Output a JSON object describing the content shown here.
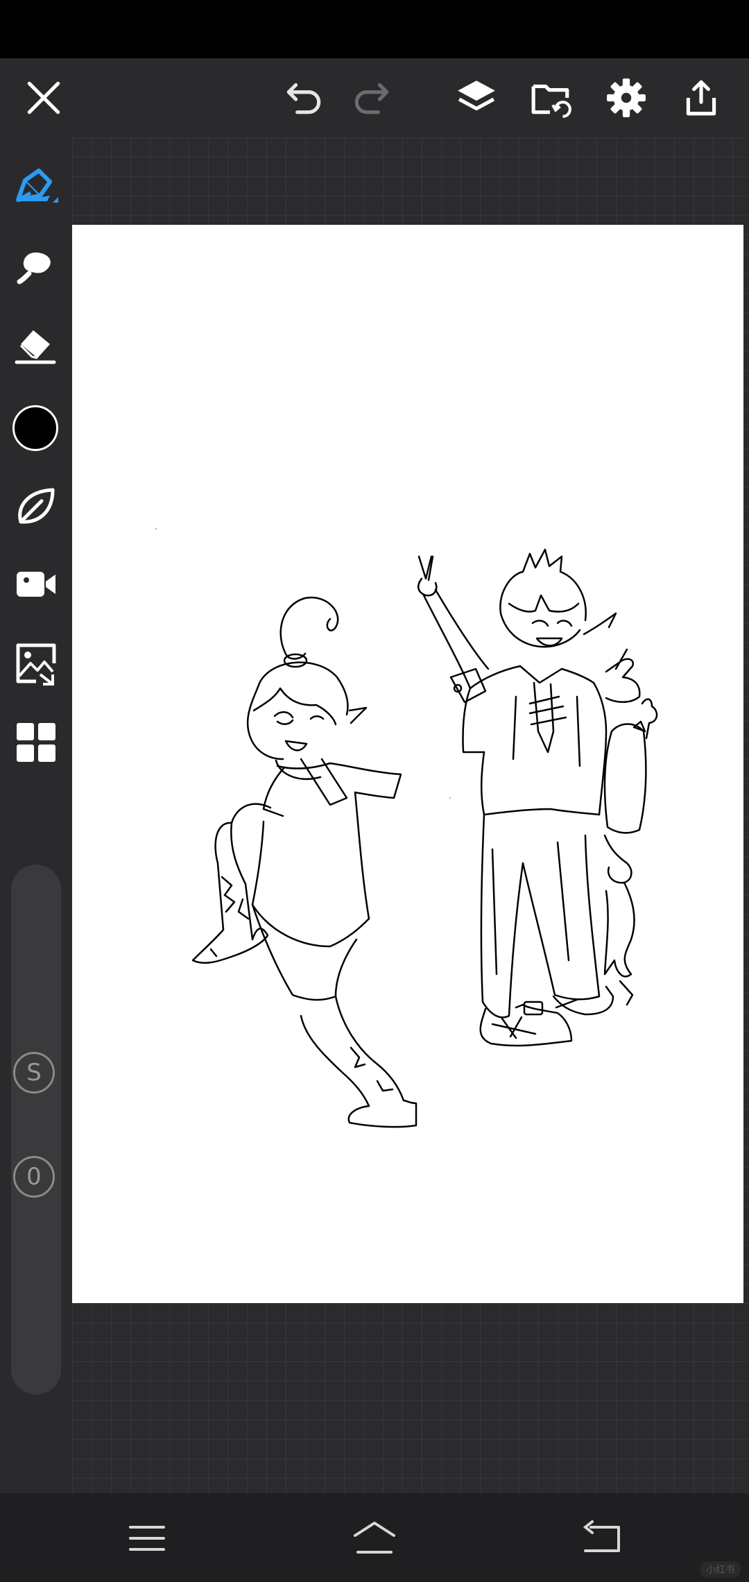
{
  "toolbar": {
    "close": "close-icon",
    "undo": "undo-icon",
    "redo": "redo-icon",
    "layers": "layers-icon",
    "import": "folder-import-icon",
    "settings": "gear-icon",
    "share": "share-icon"
  },
  "tools": [
    {
      "name": "pen-tool",
      "icon": "pen-icon",
      "active": true
    },
    {
      "name": "smudge-tool",
      "icon": "smudge-icon"
    },
    {
      "name": "eraser-tool",
      "icon": "eraser-icon"
    },
    {
      "name": "color-picker",
      "icon": "color-swatch"
    },
    {
      "name": "stabilizer-tool",
      "icon": "leaf-icon"
    },
    {
      "name": "record-tool",
      "icon": "video-icon"
    },
    {
      "name": "image-import-tool",
      "icon": "image-icon"
    },
    {
      "name": "grid-menu-tool",
      "icon": "grid-icon"
    }
  ],
  "colors": {
    "active_tool": "#2b9cf2",
    "current_color": "#000000",
    "panel_bg": "#2a2a2d"
  },
  "slider": {
    "size_label": "S",
    "opacity_label": "0"
  },
  "navigation": [
    "menu-icon",
    "home-icon",
    "back-icon"
  ],
  "watermark": "小红书"
}
